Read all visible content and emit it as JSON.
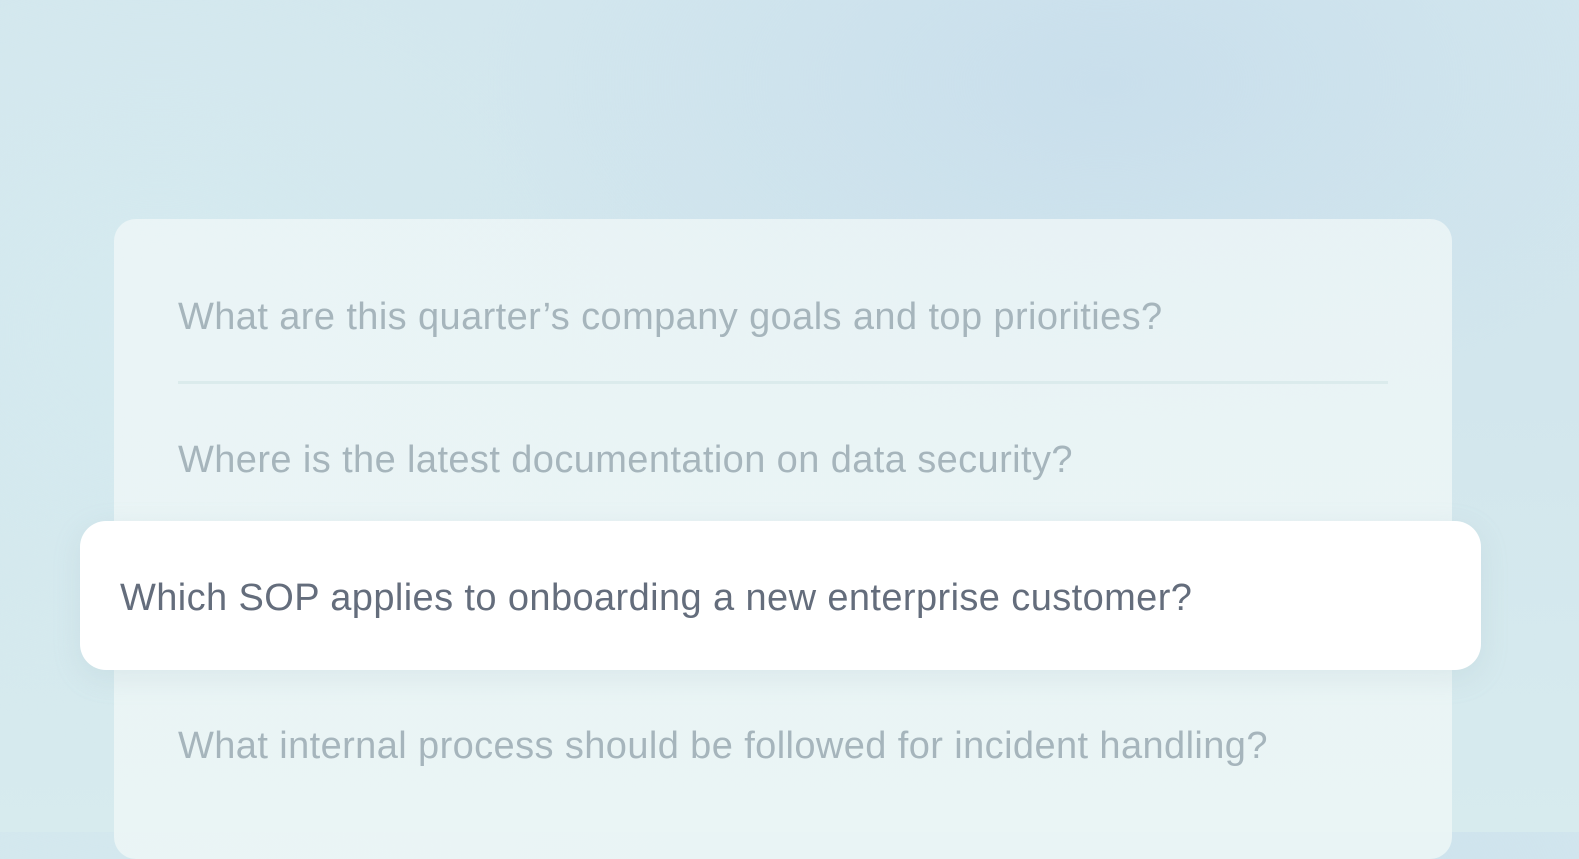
{
  "questions": [
    {
      "text": "What are this quarter’s company goals and top priorities?",
      "active": false
    },
    {
      "text": "Where is the latest documentation on data security?",
      "active": false
    },
    {
      "text": "Which SOP applies to onboarding a new enterprise customer?",
      "active": true
    },
    {
      "text": "What internal process should be followed for incident handling?",
      "active": false
    }
  ],
  "colors": {
    "inactive_text": "#a6b5bc",
    "active_text": "#646d7c",
    "active_background": "#ffffff"
  }
}
